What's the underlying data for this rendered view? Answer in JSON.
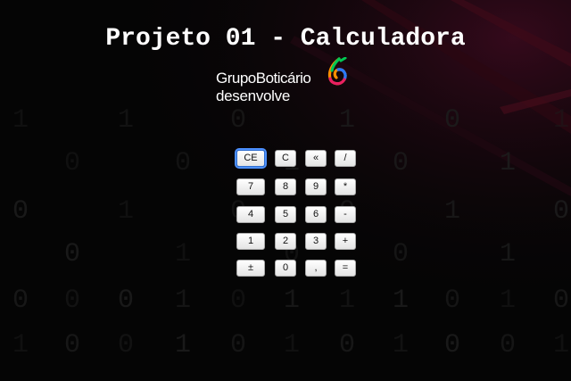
{
  "title": "Projeto 01 - Calculadora",
  "logo": {
    "line1": "GrupoBoticário",
    "line2": "desenvolve",
    "colors": [
      "#ff3d00",
      "#ffc400",
      "#00c853",
      "#2979ff",
      "#aa00ff"
    ]
  },
  "keypad": {
    "rows": [
      [
        "CE",
        "C",
        "«",
        "/"
      ],
      [
        "7",
        "8",
        "9",
        "*"
      ],
      [
        "4",
        "5",
        "6",
        "-"
      ],
      [
        "1",
        "2",
        "3",
        "+"
      ],
      [
        "±",
        "0",
        ",",
        "="
      ]
    ],
    "focused_key": "CE"
  },
  "background": {
    "digits": [
      "1",
      "1",
      "0",
      "1",
      "0",
      "1",
      "0",
      "0",
      "1",
      "0",
      "1",
      "0",
      "1",
      "0",
      "0",
      "1",
      "0",
      "0",
      "1",
      "0",
      "0",
      "1",
      "0",
      "0",
      "0",
      "1",
      "0",
      "1"
    ]
  }
}
